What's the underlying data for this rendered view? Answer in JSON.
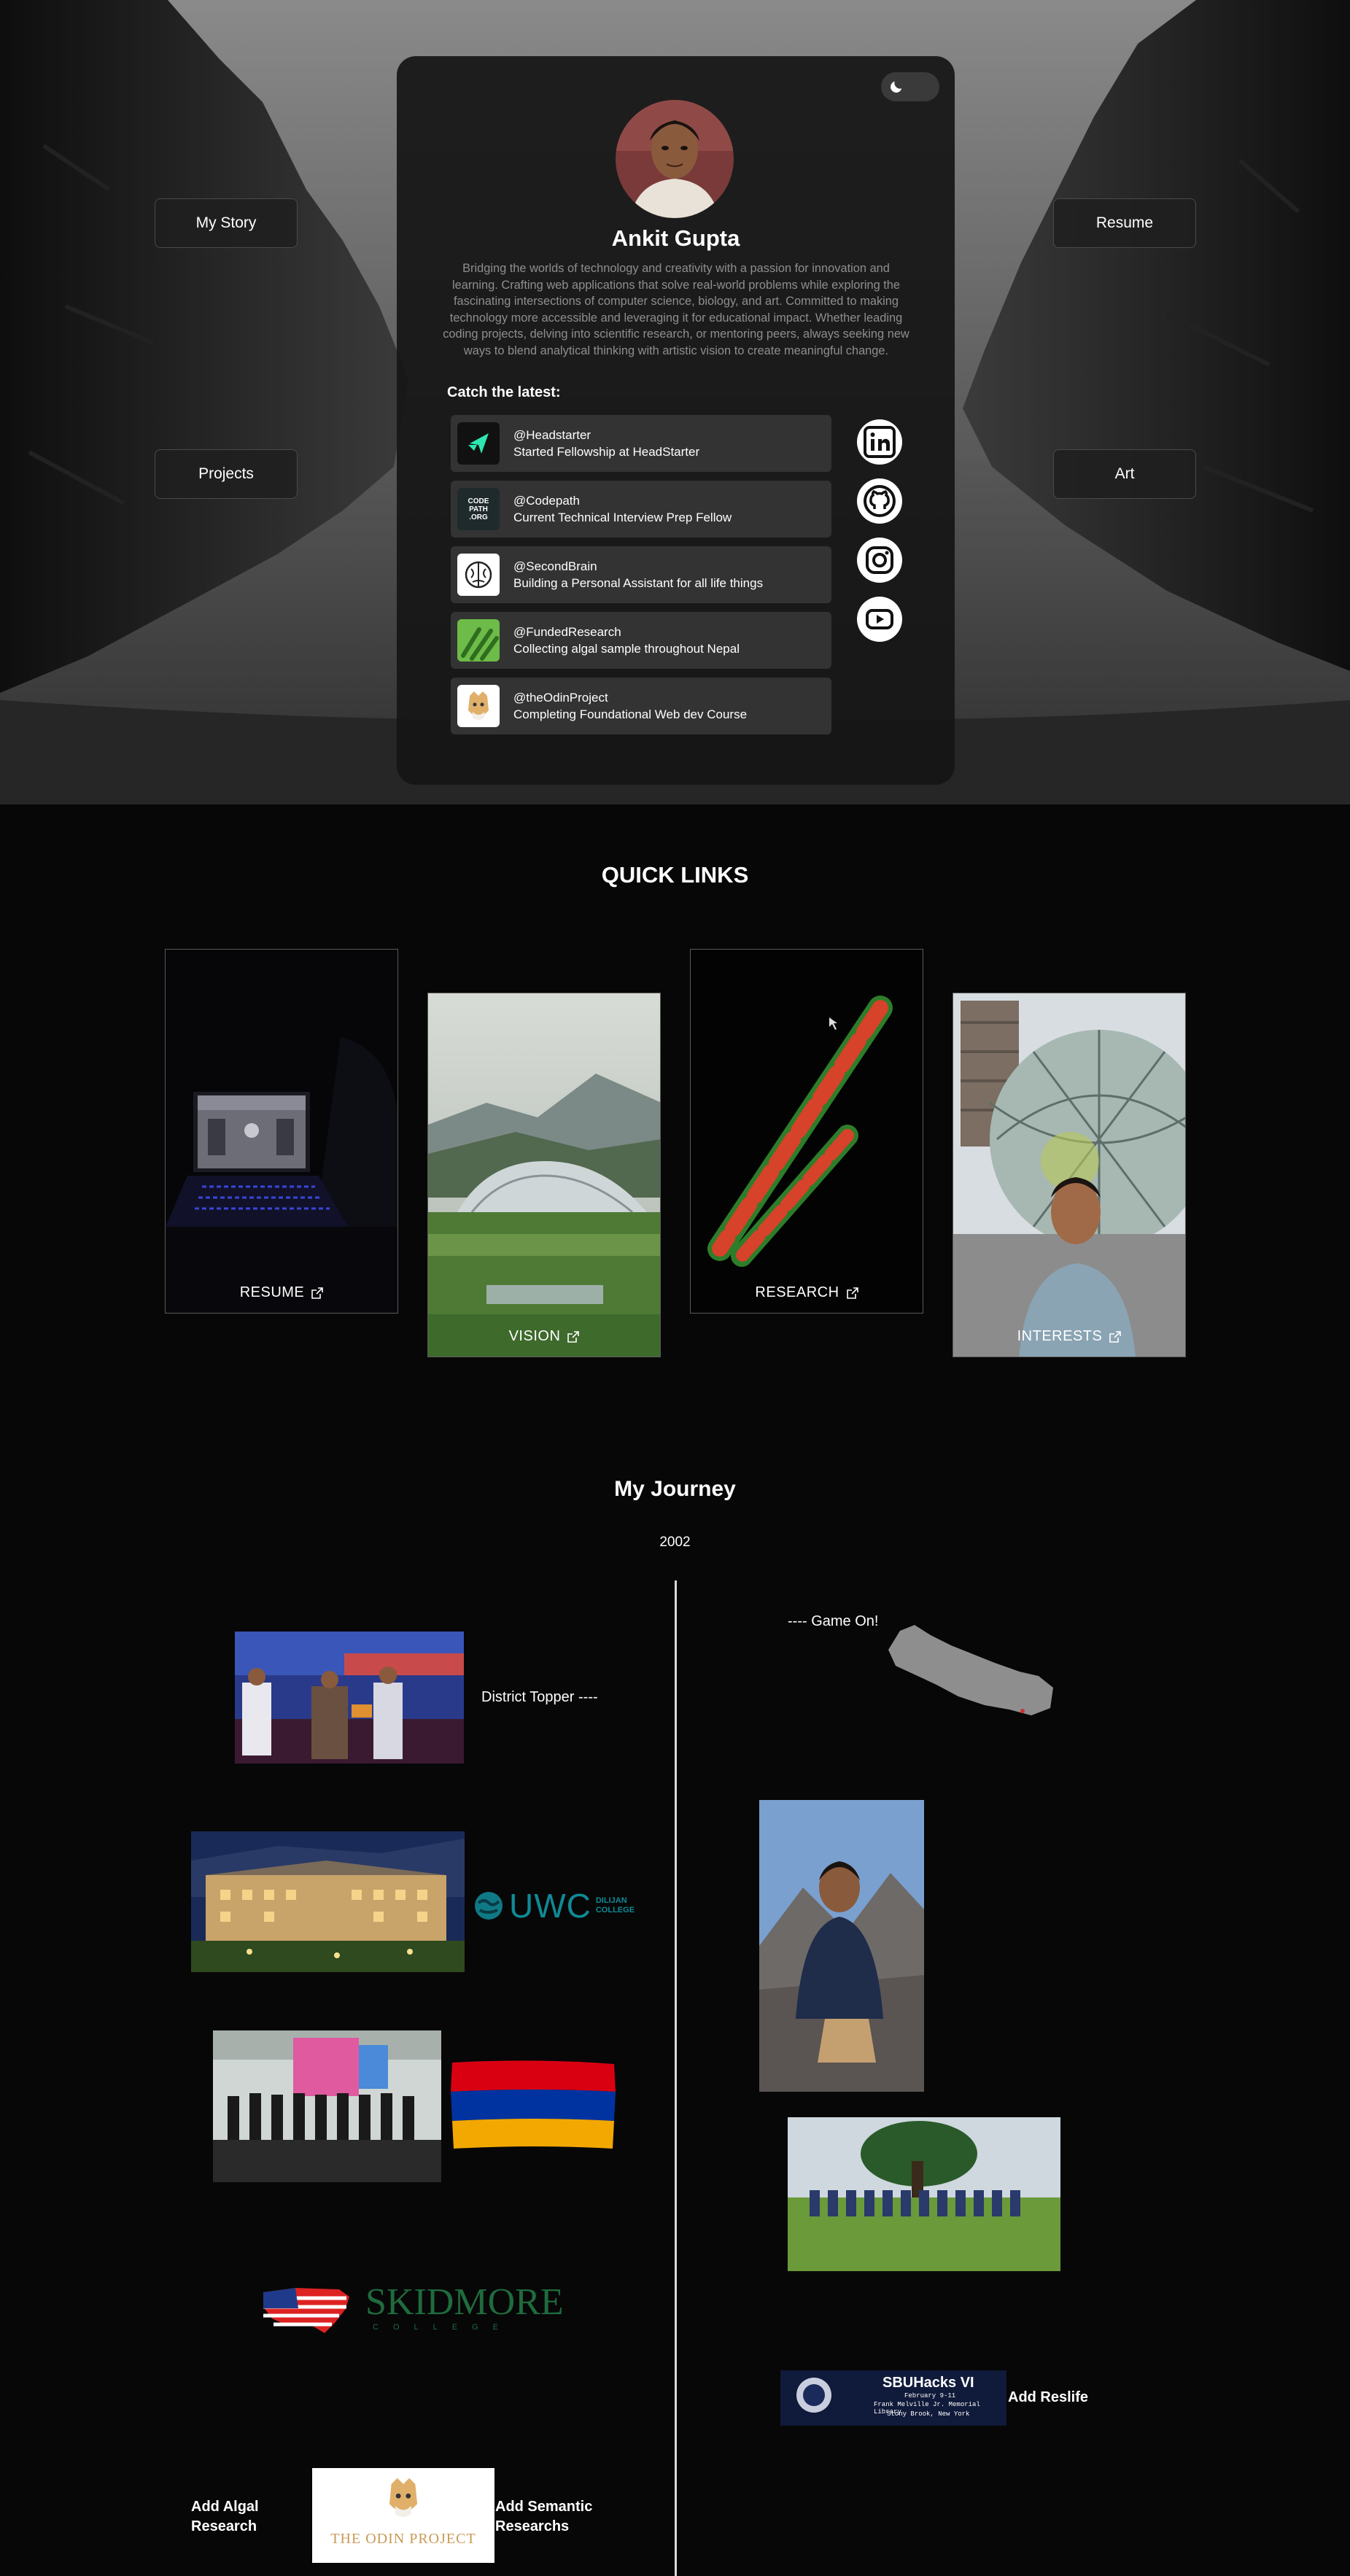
{
  "nav": {
    "my_story": "My Story",
    "resume": "Resume",
    "projects": "Projects",
    "art": "Art"
  },
  "profile": {
    "name": "Ankit Gupta",
    "bio": "Bridging the worlds of technology and creativity with a passion for innovation and learning. Crafting web applications that solve real-world problems while exploring the fascinating intersections of computer science, biology, and art. Committed to making technology more accessible and leveraging it for educational impact. Whether leading coding projects, delving into scientific research, or mentoring peers, always seeking new ways to blend analytical thinking with artistic vision to create meaningful change."
  },
  "theme_toggle": {
    "icon": "moon-icon"
  },
  "latest": {
    "title": "Catch the latest:",
    "items": [
      {
        "handle": "@Headstarter",
        "text": "Started Fellowship at HeadStarter",
        "icon": "headstarter-logo-icon"
      },
      {
        "handle": "@Codepath",
        "text": "Current Technical Interview Prep Fellow",
        "icon": "codepath-logo-icon",
        "logo_text": "CODE PATH .ORG"
      },
      {
        "handle": "@SecondBrain",
        "text": "Building a Personal Assistant for all life things",
        "icon": "brain-icon"
      },
      {
        "handle": "@FundedResearch",
        "text": "Collecting algal sample throughout Nepal",
        "icon": "algae-icon"
      },
      {
        "handle": "@theOdinProject",
        "text": "Completing Foundational Web dev Course",
        "icon": "odin-logo-icon"
      }
    ]
  },
  "socials": [
    "linkedin-icon",
    "github-icon",
    "instagram-icon",
    "youtube-icon"
  ],
  "quick_links": {
    "title": "QUICK LINKS",
    "cards": [
      {
        "label": "RESUME"
      },
      {
        "label": "VISION"
      },
      {
        "label": "RESEARCH"
      },
      {
        "label": "INTERESTS"
      }
    ]
  },
  "journey": {
    "title": "My Journey",
    "year": "2002",
    "game_on": "---- Game On!",
    "district_topper": "District Topper ----",
    "uwc_text": "UWC",
    "uwc_sub": "DILIJAN COLLEGE",
    "skidmore": "SKIDMORE",
    "skidmore_sub": "COLLEGE",
    "sbuhacks": {
      "title": "SBUHacks VI",
      "line1": "February 9-11",
      "line2": "Frank Melville Jr. Memorial Library",
      "line3": "Stony Brook, New York"
    },
    "odin_logo": "THE ODIN PROJECT",
    "add_reslife": "Add Reslife",
    "add_algal_1": "Add Algal",
    "add_algal_2": "Research",
    "add_semantic_1": "Add Semantic",
    "add_semantic_2": "Researchs"
  },
  "colors": {
    "card_bg": "#161616",
    "news_bg": "#333333",
    "page_bg": "#070707",
    "bio": "#8e8e8e"
  }
}
